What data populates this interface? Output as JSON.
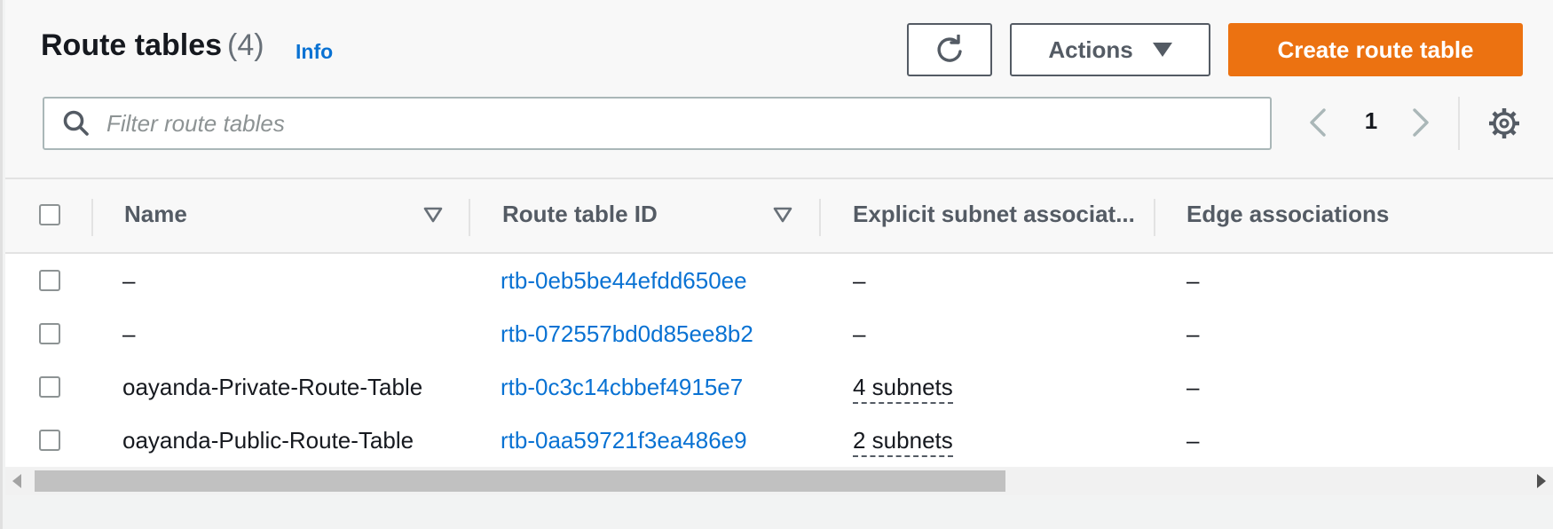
{
  "header": {
    "title": "Route tables",
    "count": "(4)",
    "info_link": "Info",
    "actions_label": "Actions",
    "create_label": "Create route table"
  },
  "search": {
    "placeholder": "Filter route tables",
    "value": ""
  },
  "pagination": {
    "current_page": "1"
  },
  "table": {
    "columns": {
      "name": "Name",
      "route_table_id": "Route table ID",
      "explicit_subnet": "Explicit subnet associat...",
      "edge_associations": "Edge associations"
    },
    "rows": [
      {
        "name": "–",
        "route_table_id": "rtb-0eb5be44efdd650ee",
        "explicit_subnet": "–",
        "edge_associations": "–"
      },
      {
        "name": "–",
        "route_table_id": "rtb-072557bd0d85ee8b2",
        "explicit_subnet": "–",
        "edge_associations": "–"
      },
      {
        "name": "oayanda-Private-Route-Table",
        "route_table_id": "rtb-0c3c14cbbef4915e7",
        "explicit_subnet": "4 subnets",
        "edge_associations": "–"
      },
      {
        "name": "oayanda-Public-Route-Table",
        "route_table_id": "rtb-0aa59721f3ea486e9",
        "explicit_subnet": "2 subnets",
        "edge_associations": "–"
      }
    ]
  },
  "icons": {
    "refresh": "refresh-icon",
    "caret": "caret-down-icon",
    "search": "search-icon",
    "prev": "chevron-left-icon",
    "next": "chevron-right-icon",
    "settings": "gear-icon",
    "sort": "sort-down-icon"
  },
  "colors": {
    "primary_button": "#ec7211",
    "link": "#0972d3",
    "text": "#16191f",
    "secondary_text": "#545b64"
  }
}
